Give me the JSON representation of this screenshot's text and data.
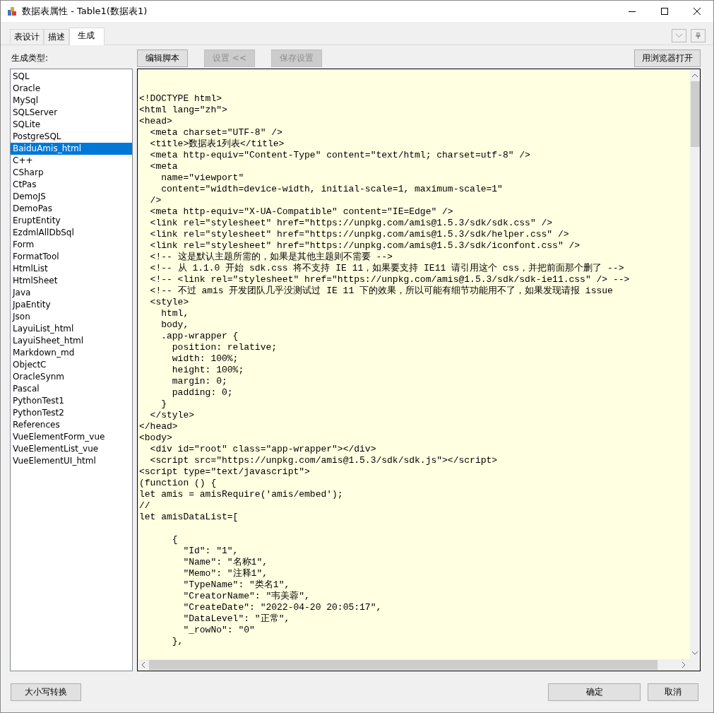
{
  "window": {
    "title": "数据表属性 - Table1(数据表1)"
  },
  "tabs": [
    {
      "label": "表设计",
      "selected": false
    },
    {
      "label": "描述",
      "selected": false
    },
    {
      "label": "生成",
      "selected": true
    }
  ],
  "generate_type_label": "生成类型:",
  "types": [
    {
      "label": "SQL",
      "selected": false
    },
    {
      "label": "Oracle",
      "selected": false
    },
    {
      "label": "MySql",
      "selected": false
    },
    {
      "label": "SQLServer",
      "selected": false
    },
    {
      "label": "SQLite",
      "selected": false
    },
    {
      "label": "PostgreSQL",
      "selected": false
    },
    {
      "label": "BaiduAmis_html",
      "selected": true
    },
    {
      "label": "C++",
      "selected": false
    },
    {
      "label": "CSharp",
      "selected": false
    },
    {
      "label": "CtPas",
      "selected": false
    },
    {
      "label": "DemoJS",
      "selected": false
    },
    {
      "label": "DemoPas",
      "selected": false
    },
    {
      "label": "EruptEntity",
      "selected": false
    },
    {
      "label": "EzdmlAllDbSql",
      "selected": false
    },
    {
      "label": "Form",
      "selected": false
    },
    {
      "label": "FormatTool",
      "selected": false
    },
    {
      "label": "HtmlList",
      "selected": false
    },
    {
      "label": "HtmlSheet",
      "selected": false
    },
    {
      "label": "Java",
      "selected": false
    },
    {
      "label": "JpaEntity",
      "selected": false
    },
    {
      "label": "Json",
      "selected": false
    },
    {
      "label": "LayuiList_html",
      "selected": false
    },
    {
      "label": "LayuiSheet_html",
      "selected": false
    },
    {
      "label": "Markdown_md",
      "selected": false
    },
    {
      "label": "ObjectC",
      "selected": false
    },
    {
      "label": "OracleSynm",
      "selected": false
    },
    {
      "label": "Pascal",
      "selected": false
    },
    {
      "label": "PythonTest1",
      "selected": false
    },
    {
      "label": "PythonTest2",
      "selected": false
    },
    {
      "label": "References",
      "selected": false
    },
    {
      "label": "VueElementForm_vue",
      "selected": false
    },
    {
      "label": "VueElementList_vue",
      "selected": false
    },
    {
      "label": "VueElementUI_html",
      "selected": false
    }
  ],
  "toolbar_buttons": [
    {
      "label": "编辑脚本",
      "disabled": false
    },
    {
      "label": "设置 <<",
      "disabled": true
    },
    {
      "label": "保存设置",
      "disabled": true
    }
  ],
  "open_browser_button": "用浏览器打开",
  "code": "<!DOCTYPE html>\n<html lang=\"zh\">\n<head>\n  <meta charset=\"UTF-8\" />\n  <title>数据表1列表</title>\n  <meta http-equiv=\"Content-Type\" content=\"text/html; charset=utf-8\" />\n  <meta\n    name=\"viewport\"\n    content=\"width=device-width, initial-scale=1, maximum-scale=1\"\n  />\n  <meta http-equiv=\"X-UA-Compatible\" content=\"IE=Edge\" />\n  <link rel=\"stylesheet\" href=\"https://unpkg.com/amis@1.5.3/sdk/sdk.css\" />\n  <link rel=\"stylesheet\" href=\"https://unpkg.com/amis@1.5.3/sdk/helper.css\" />\n  <link rel=\"stylesheet\" href=\"https://unpkg.com/amis@1.5.3/sdk/iconfont.css\" />\n  <!-- 这是默认主题所需的，如果是其他主题则不需要 -->\n  <!-- 从 1.1.0 开始 sdk.css 将不支持 IE 11，如果要支持 IE11 请引用这个 css，并把前面那个删了 -->\n  <!-- <link rel=\"stylesheet\" href=\"https://unpkg.com/amis@1.5.3/sdk/sdk-ie11.css\" /> -->\n  <!-- 不过 amis 开发团队几乎没测试过 IE 11 下的效果，所以可能有细节功能用不了，如果发现请报 issue\n  <style>\n    html,\n    body,\n    .app-wrapper {\n      position: relative;\n      width: 100%;\n      height: 100%;\n      margin: 0;\n      padding: 0;\n    }\n  </style>\n</head>\n<body>\n  <div id=\"root\" class=\"app-wrapper\"></div>\n  <script src=\"https://unpkg.com/amis@1.5.3/sdk/sdk.js\"></script>\n<script type=\"text/javascript\">\n(function () {\nlet amis = amisRequire('amis/embed');\n//\nlet amisDataList=[\n\n      {\n        \"Id\": \"1\",\n        \"Name\": \"名称1\",\n        \"Memo\": \"注释1\",\n        \"TypeName\": \"类名1\",\n        \"CreatorName\": \"韦美蓉\",\n        \"CreateDate\": \"2022-04-20 20:05:17\",\n        \"DataLevel\": \"正常\",\n        \"_rowNo\": \"0\"\n      },",
  "footer": {
    "case_button": "大小写转换",
    "ok_button": "确定",
    "cancel_button": "取消"
  }
}
